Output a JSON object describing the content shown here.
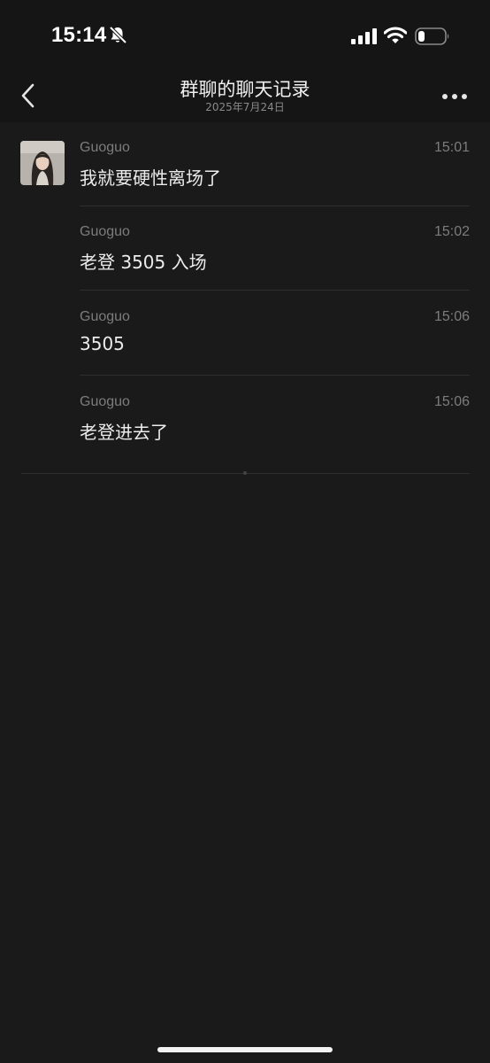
{
  "status_bar": {
    "time": "15:14",
    "icons": [
      "bell-slash-icon",
      "cellular-signal-icon",
      "wifi-icon",
      "battery-low-icon"
    ],
    "battery_level": 0.25
  },
  "nav": {
    "back_icon": "chevron-left-icon",
    "title": "群聊的聊天记录",
    "subtitle": "2025年7月24日",
    "more_icon": "more-horizontal-icon"
  },
  "messages": [
    {
      "sender": "Guoguo",
      "time": "15:01",
      "text": "我就要硬性离场了"
    },
    {
      "sender": "Guoguo",
      "time": "15:02",
      "text": "老登 3505 入场"
    },
    {
      "sender": "Guoguo",
      "time": "15:06",
      "text": "3505"
    },
    {
      "sender": "Guoguo",
      "time": "15:06",
      "text": "老登进去了"
    }
  ],
  "colors": {
    "background": "#1a1a1a",
    "header": "#151515",
    "primary_text": "#ececec",
    "secondary_text": "#7c7c7c",
    "divider": "#2e2e2e"
  }
}
